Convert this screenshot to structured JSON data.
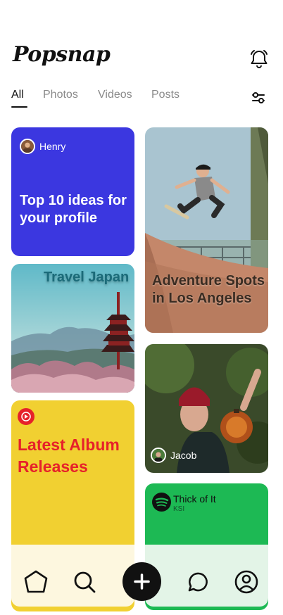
{
  "app": {
    "title": "Popsnap"
  },
  "tabs": [
    {
      "label": "All",
      "active": true
    },
    {
      "label": "Photos",
      "active": false
    },
    {
      "label": "Videos",
      "active": false
    },
    {
      "label": "Posts",
      "active": false
    }
  ],
  "cards": {
    "henry": {
      "author": "Henry",
      "title": "Top 10 ideas for your profile",
      "bg": "#3b37e0"
    },
    "travel": {
      "title": "Travel Japan"
    },
    "album": {
      "title": "Latest Album Releases",
      "bg": "#f1d031",
      "text_color": "#e6212a"
    },
    "adventure": {
      "title": "Adventure Spots in Los Angeles"
    },
    "jacob": {
      "author": "Jacob"
    },
    "spotify": {
      "track": "Thick of It",
      "artist": "KSI",
      "bg": "#1db954"
    }
  },
  "icons": {
    "bell": "bell-icon",
    "filter": "filter-icon",
    "youtube_music": "youtube-music-icon",
    "spotify": "spotify-icon",
    "home": "home-icon",
    "search": "search-icon",
    "add": "plus-icon",
    "chat": "chat-icon",
    "profile": "profile-icon"
  }
}
